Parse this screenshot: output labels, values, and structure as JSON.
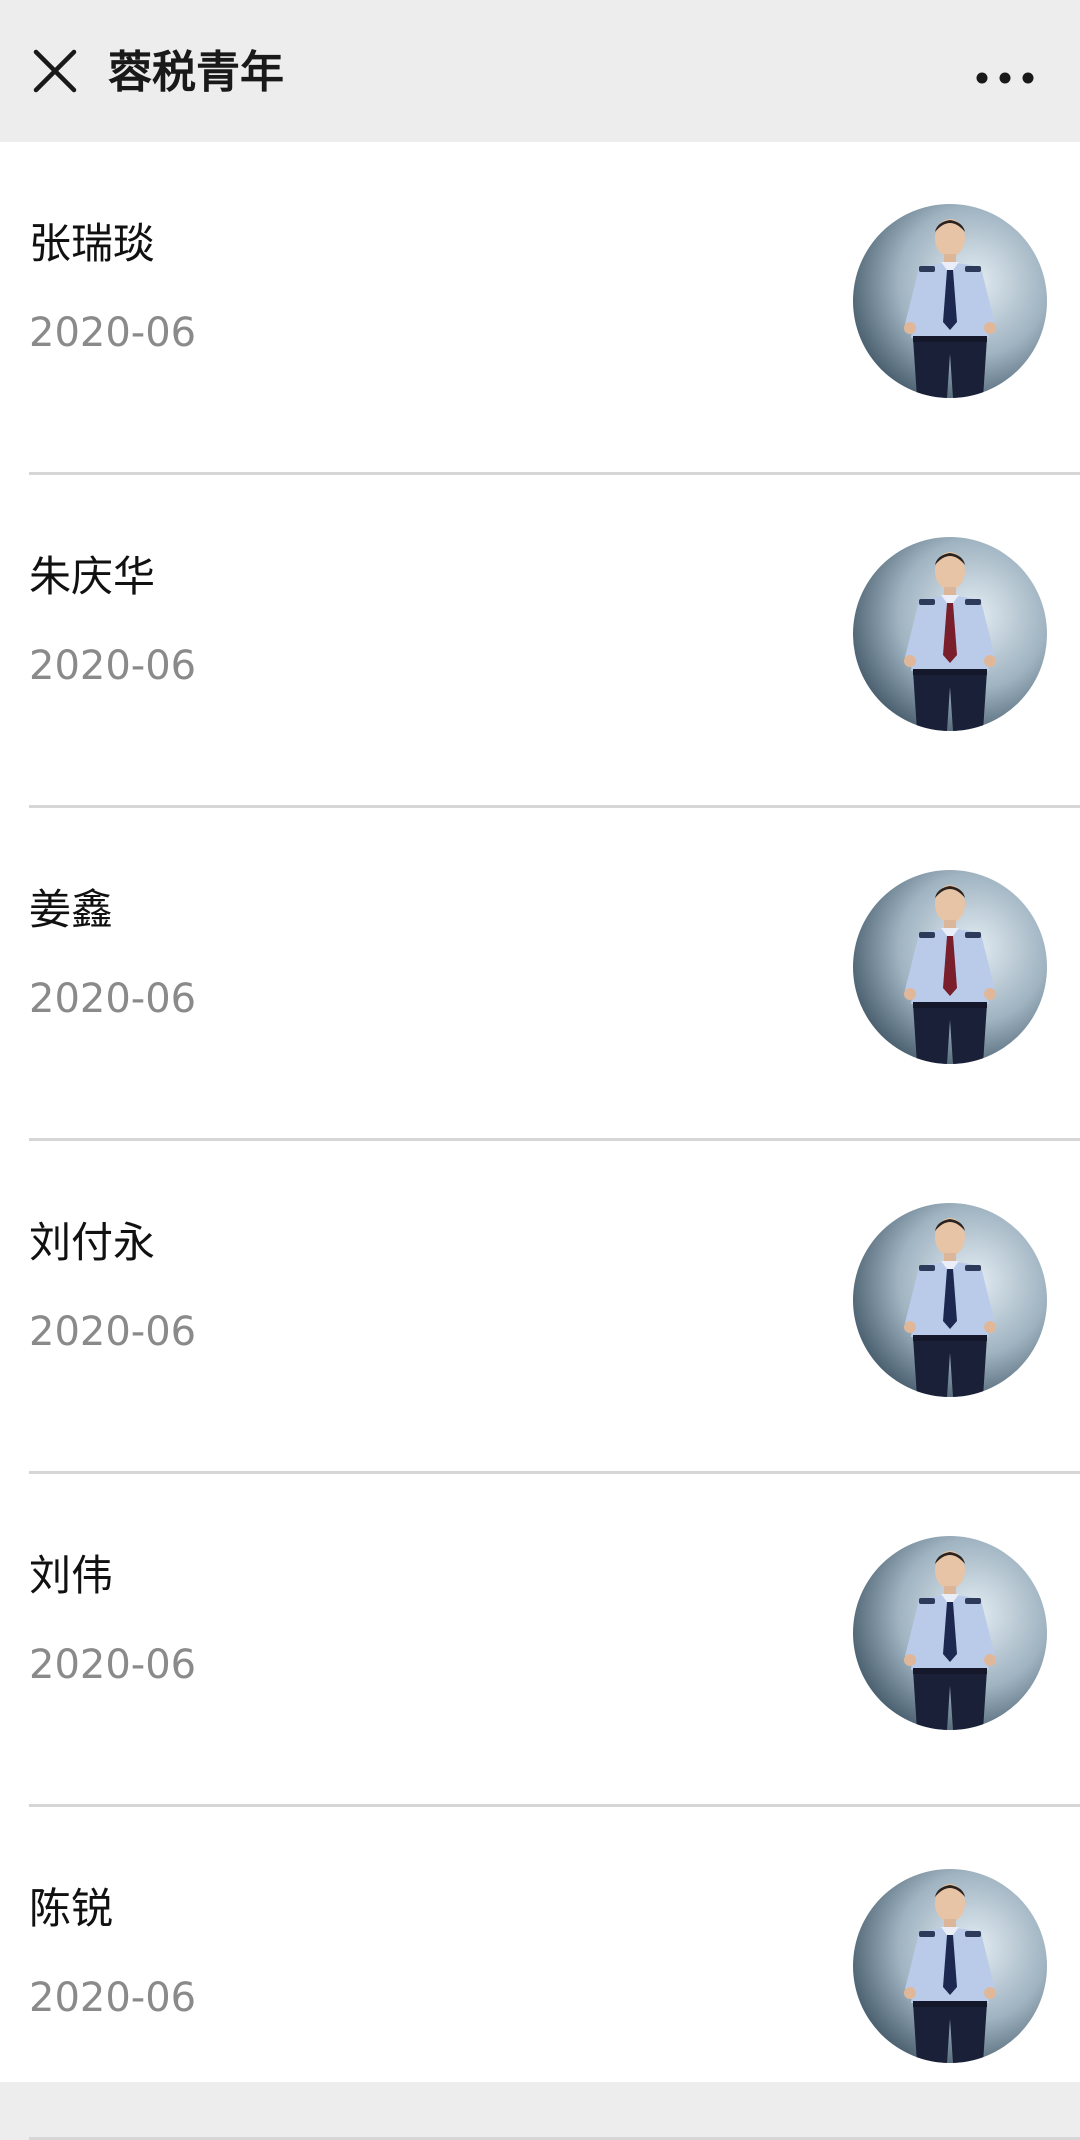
{
  "header": {
    "title": "蓉税青年",
    "close_icon": "close-icon",
    "more_icon": "more-dots-icon"
  },
  "articles": [
    {
      "name": "张瑞琰",
      "date": "2020-06",
      "tie_color": "#1c2850"
    },
    {
      "name": "朱庆华",
      "date": "2020-06",
      "tie_color": "#7a1e2c"
    },
    {
      "name": "姜鑫",
      "date": "2020-06",
      "tie_color": "#7a1e2c"
    },
    {
      "name": "刘付永",
      "date": "2020-06",
      "tie_color": "#1c2850"
    },
    {
      "name": "刘伟",
      "date": "2020-06",
      "tie_color": "#1c2850"
    },
    {
      "name": "陈锐",
      "date": "2020-06",
      "tie_color": "#1c2850"
    }
  ],
  "colors": {
    "header_bg": "#ededed",
    "list_bg": "#ffffff",
    "divider": "#d6d6d6",
    "date_text": "#8a8a8a",
    "uniform_shirt": "#b9cbe8",
    "pants": "#1a2038"
  }
}
